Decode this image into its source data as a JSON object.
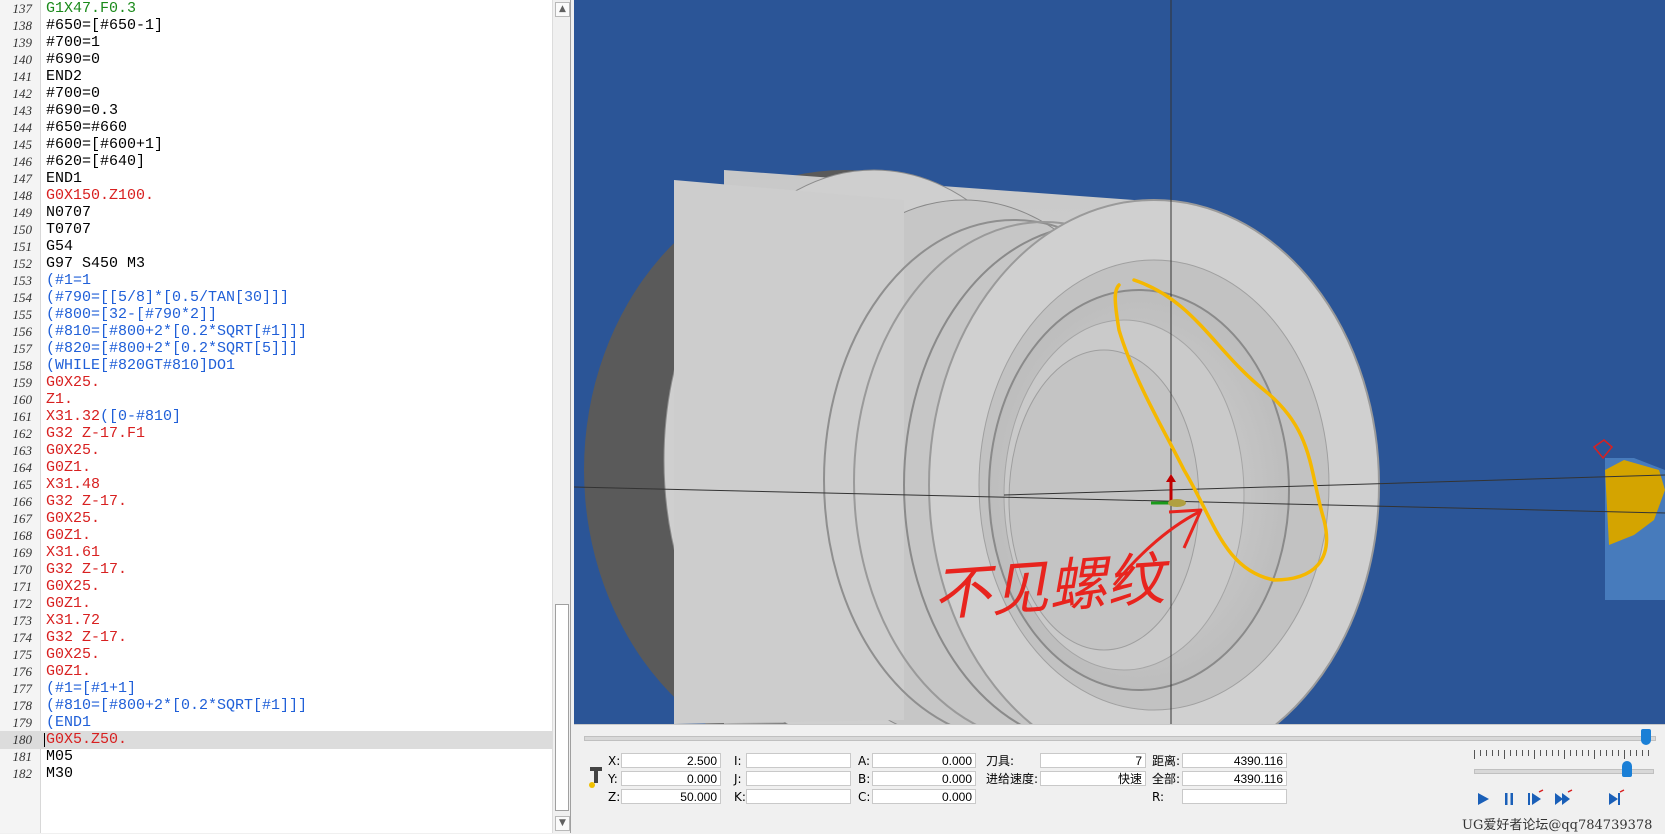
{
  "editor": {
    "current_line": 180,
    "colors": {
      "black": "#000000",
      "red": "#d82020",
      "blue": "#1f5fd8",
      "green": "#1a8a1a",
      "current_line_bg": "#dcdcdc"
    },
    "lines": [
      {
        "no": "137",
        "text": "G1X47.F0.3",
        "color": "green"
      },
      {
        "no": "138",
        "text": "#650=[#650-1]",
        "color": "black"
      },
      {
        "no": "139",
        "text": "#700=1",
        "color": "black"
      },
      {
        "no": "140",
        "text": "#690=0",
        "color": "black"
      },
      {
        "no": "141",
        "text": "END2",
        "color": "black"
      },
      {
        "no": "142",
        "text": "#700=0",
        "color": "black"
      },
      {
        "no": "143",
        "text": "#690=0.3",
        "color": "black"
      },
      {
        "no": "144",
        "text": "#650=#660",
        "color": "black"
      },
      {
        "no": "145",
        "text": "#600=[#600+1]",
        "color": "black"
      },
      {
        "no": "146",
        "text": "#620=[#640]",
        "color": "black"
      },
      {
        "no": "147",
        "text": "END1",
        "color": "black"
      },
      {
        "no": "148",
        "text": "G0X150.Z100.",
        "color": "red"
      },
      {
        "no": "149",
        "text": "N0707",
        "color": "black"
      },
      {
        "no": "150",
        "text": "T0707",
        "color": "black"
      },
      {
        "no": "151",
        "text": "G54",
        "color": "black"
      },
      {
        "no": "152",
        "text": "G97 S450 M3",
        "color": "black"
      },
      {
        "no": "153",
        "text": "(#1=1",
        "color": "blue"
      },
      {
        "no": "154",
        "text": "(#790=[[5/8]*[0.5/TAN[30]]]",
        "color": "blue"
      },
      {
        "no": "155",
        "text": "(#800=[32-[#790*2]]",
        "color": "blue"
      },
      {
        "no": "156",
        "text": "(#810=[#800+2*[0.2*SQRT[#1]]]",
        "color": "blue"
      },
      {
        "no": "157",
        "text": "(#820=[#800+2*[0.2*SQRT[5]]]",
        "color": "blue"
      },
      {
        "no": "158",
        "text": "(WHILE[#820GT#810]DO1",
        "color": "blue"
      },
      {
        "no": "159",
        "text": "G0X25.",
        "color": "red"
      },
      {
        "no": "160",
        "text": "Z1.",
        "color": "red"
      },
      {
        "no": "161",
        "text": "X31.32",
        "color": "red",
        "extra": "([0-#810]",
        "extra_color": "blue"
      },
      {
        "no": "162",
        "text": "G32 Z-17.F1",
        "color": "red"
      },
      {
        "no": "163",
        "text": "G0X25.",
        "color": "red"
      },
      {
        "no": "164",
        "text": "G0Z1.",
        "color": "red"
      },
      {
        "no": "165",
        "text": "X31.48",
        "color": "red"
      },
      {
        "no": "166",
        "text": "G32 Z-17.",
        "color": "red"
      },
      {
        "no": "167",
        "text": "G0X25.",
        "color": "red"
      },
      {
        "no": "168",
        "text": "G0Z1.",
        "color": "red"
      },
      {
        "no": "169",
        "text": "X31.61",
        "color": "red"
      },
      {
        "no": "170",
        "text": "G32 Z-17.",
        "color": "red"
      },
      {
        "no": "171",
        "text": "G0X25.",
        "color": "red"
      },
      {
        "no": "172",
        "text": "G0Z1.",
        "color": "red"
      },
      {
        "no": "173",
        "text": "X31.72",
        "color": "red"
      },
      {
        "no": "174",
        "text": "G32 Z-17.",
        "color": "red"
      },
      {
        "no": "175",
        "text": "G0X25.",
        "color": "red"
      },
      {
        "no": "176",
        "text": "G0Z1.",
        "color": "red"
      },
      {
        "no": "177",
        "text": "(#1=[#1+1]",
        "color": "blue"
      },
      {
        "no": "178",
        "text": "(#810=[#800+2*[0.2*SQRT[#1]]]",
        "color": "blue"
      },
      {
        "no": "179",
        "text": "(END1",
        "color": "blue"
      },
      {
        "no": "180",
        "text": "G0X5.Z50.",
        "color": "red"
      },
      {
        "no": "181",
        "text": "M05",
        "color": "black"
      },
      {
        "no": "182",
        "text": "M30",
        "color": "black"
      }
    ],
    "scroll_up_icon": "triangle-up",
    "scroll_down_icon": "triangle-down"
  },
  "viewport": {
    "background": "#2b5597",
    "annotation_text": "不见螺纹",
    "annotation_color": "#e8241e",
    "highlight_color": "#f5b800",
    "tool_color": "#d4a400"
  },
  "coords": {
    "x_label": "X:",
    "x_value": "2.500",
    "y_label": "Y:",
    "y_value": "0.000",
    "z_label": "Z:",
    "z_value": "50.000",
    "i_label": "I:",
    "i_value": "",
    "j_label": "J:",
    "j_value": "",
    "k_label": "K:",
    "k_value": "",
    "a_label": "A:",
    "a_value": "0.000",
    "b_label": "B:",
    "b_value": "0.000",
    "c_label": "C:",
    "c_value": "0.000",
    "tool_label": "刀具:",
    "tool_value": "7",
    "feed_label": "进给速度:",
    "feed_value": "快速",
    "distance_label": "距离:",
    "distance_value": "4390.116",
    "total_label": "全部:",
    "total_value": "4390.116",
    "r_label": "R:",
    "r_value": ""
  },
  "playback": {
    "progress": 1.0,
    "speed": 0.85,
    "buttons": [
      "play-icon",
      "pause-icon",
      "step-forward-icon",
      "fast-forward-icon",
      "skip-to-end-icon"
    ]
  },
  "watermark": "UG爱好者论坛@qq784739378"
}
